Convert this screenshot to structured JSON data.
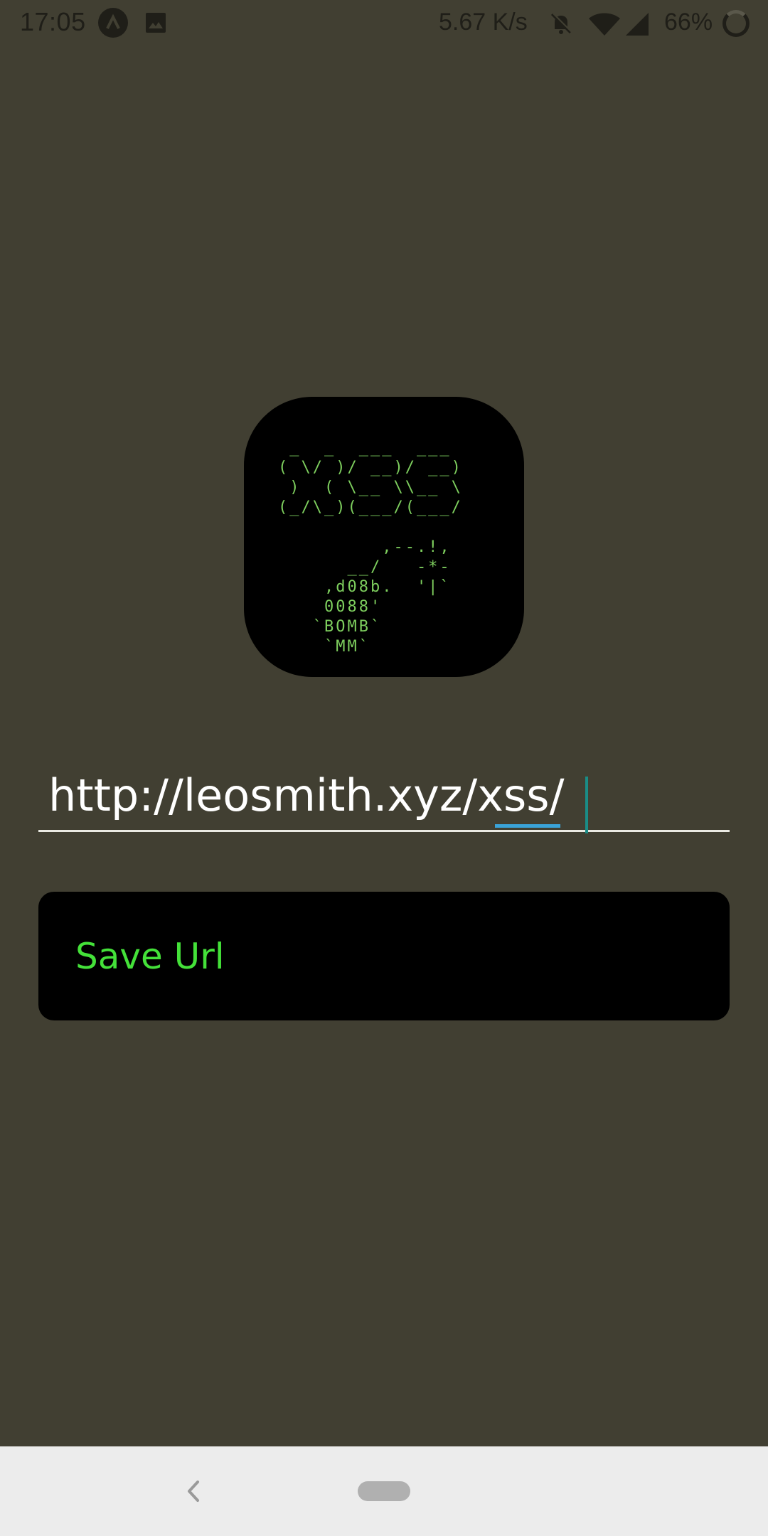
{
  "status_bar": {
    "time": "17:05",
    "net_speed": "5.67 K/s",
    "battery": "66%",
    "icons": [
      "app-notification-icon",
      "image-icon",
      "bell-off-icon",
      "wifi-icon",
      "cell-signal-icon",
      "battery-icon"
    ]
  },
  "logo": {
    "ascii_art": " _  _  ___  ___\n( \\/ )/ __)/ __)\n )  ( \\__ \\\\__ \\\n(_/\\_)(___/(___/\n\n         ,--.!,\n      __/   -*-\n    ,d08b.  '|`\n    0088'\n   `BOMB`\n    `MM`"
  },
  "url_field": {
    "value": "http://leosmith.xyz/xss/"
  },
  "save_button": {
    "label": "Save Url"
  },
  "colors": {
    "background": "#413f32",
    "accent_green": "#44e139",
    "button_bg": "#000000"
  }
}
